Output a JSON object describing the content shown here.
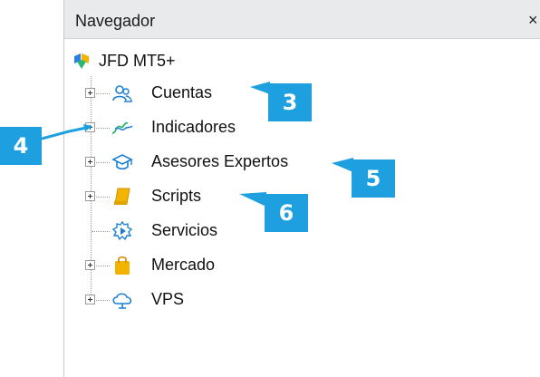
{
  "navigator": {
    "title": "Navegador",
    "close_glyph": "×",
    "root": {
      "label": "JFD MT5+",
      "icon": "metatrader-logo-icon"
    },
    "items": [
      {
        "label": "Cuentas",
        "icon": "accounts-icon",
        "expandable": true
      },
      {
        "label": "Indicadores",
        "icon": "indicators-icon",
        "expandable": true
      },
      {
        "label": "Asesores Expertos",
        "icon": "expert-advisors-icon",
        "expandable": true
      },
      {
        "label": "Scripts",
        "icon": "scripts-icon",
        "expandable": true
      },
      {
        "label": "Servicios",
        "icon": "services-icon",
        "expandable": false
      },
      {
        "label": "Mercado",
        "icon": "market-icon",
        "expandable": true
      },
      {
        "label": "VPS",
        "icon": "vps-cloud-icon",
        "expandable": true
      }
    ]
  },
  "callouts": [
    {
      "number": "3",
      "target": "Cuentas"
    },
    {
      "number": "4",
      "target": "Indicadores"
    },
    {
      "number": "5",
      "target": "Asesores Expertos"
    },
    {
      "number": "6",
      "target": "Scripts"
    }
  ],
  "colors": {
    "callout": "#1ea0e0",
    "titlebar": "#e9eaec",
    "icon_blue": "#1c7fd1",
    "icon_green": "#2bb673",
    "icon_gold": "#f2b400"
  }
}
